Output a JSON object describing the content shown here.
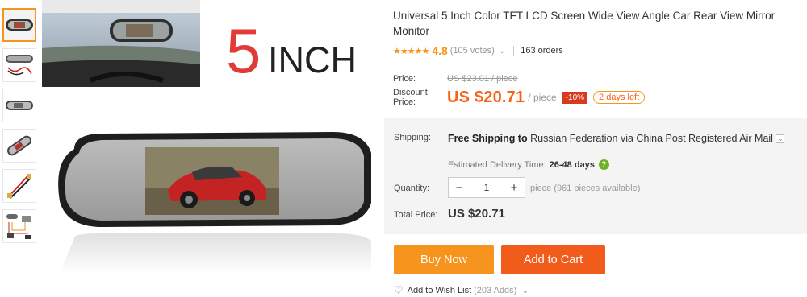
{
  "product": {
    "title": "Universal 5 Inch Color TFT LCD Screen Wide View Angle Car Rear View Mirror Monitor",
    "stars": "★★★★★",
    "rating": "4.8",
    "votes": "(105 votes)",
    "orders": "163 orders",
    "hero_text_number": "5",
    "hero_text_unit": "INCH"
  },
  "price": {
    "price_label": "Price:",
    "old_price": "US $23.01 / piece",
    "discount_label": "Discount Price:",
    "new_price": "US $20.71",
    "per": "/ piece",
    "discount": "-10%",
    "days_left": "2 days left"
  },
  "shipping": {
    "label": "Shipping:",
    "bold": "Free Shipping to",
    "destination": "Russian Federation via China Post Registered Air",
    "method": "Mail",
    "eta_label": "Estimated Delivery Time:",
    "eta_days": "26-48 days"
  },
  "quantity": {
    "label": "Quantity:",
    "minus": "−",
    "value": "1",
    "plus": "+",
    "available": "piece (961 pieces available)"
  },
  "total": {
    "label": "Total Price:",
    "value": "US $20.71"
  },
  "actions": {
    "buy_now": "Buy Now",
    "add_to_cart": "Add to Cart",
    "wish_label": "Add to Wish List",
    "wish_count": "(203 Adds)"
  },
  "colors": {
    "accent_orange": "#f7941d",
    "cart_orange": "#f25c1b",
    "price_red": "#f7631d",
    "badge_red": "#d73a1f",
    "hero_red": "#e03b36"
  },
  "icons": [
    "star-icon",
    "chevron-down-icon",
    "help-icon",
    "heart-icon"
  ]
}
